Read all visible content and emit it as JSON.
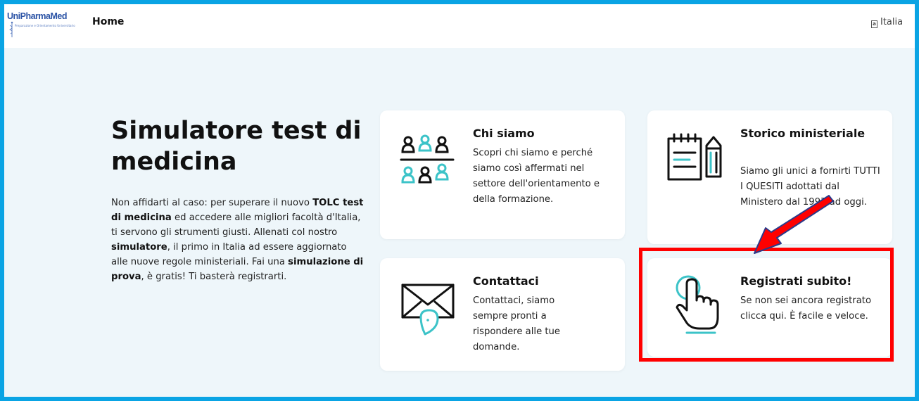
{
  "navbar": {
    "logo_text": "UniPharmaMed",
    "logo_subtitle": "Preparazione e Orientamento Universitario",
    "home_label": "Home",
    "language_label": "Italia"
  },
  "hero": {
    "title": "Simulatore test di medicina",
    "paragraph": {
      "t1": "Non affidarti al caso: per superare il nuovo ",
      "b1": "TOLC test di medicina",
      "t2": " ed accedere alle migliori facoltà d'Italia, ti servono gli strumenti giusti. Allenati col nostro ",
      "b2": "simulatore",
      "t3": ", il primo in Italia ad essere aggiornato alle nuove regole ministeriali. Fai una ",
      "b3": "simulazione di prova",
      "t4": ", è gratis! Ti basterà registrarti."
    }
  },
  "cards": {
    "chi_siamo": {
      "title": "Chi siamo",
      "text": "Scopri chi siamo e perché siamo così affermati nel settore dell'orientamento e della formazione.",
      "icon": "team-icon"
    },
    "storico": {
      "title": "Storico ministeriale",
      "text": "Siamo gli unici a fornirti TUTTI I QUESITI adottati dal Ministero dal 1997 ad oggi.",
      "icon": "notepad-pencil-icon"
    },
    "contattaci": {
      "title": "Contattaci",
      "text": "Contattaci, siamo sempre pronti a rispondere alle tue domande.",
      "icon": "envelope-icon"
    },
    "registrati": {
      "title": "Registrati subito!",
      "text": "Se non sei ancora registrato clicca qui.  È facile e veloce.",
      "icon": "hand-pointer-icon"
    }
  },
  "colors": {
    "frame_border": "#0aa4e4",
    "page_bg": "#eef6fa",
    "accent_teal": "#3cc3c8",
    "highlight_red": "#ff0000"
  }
}
